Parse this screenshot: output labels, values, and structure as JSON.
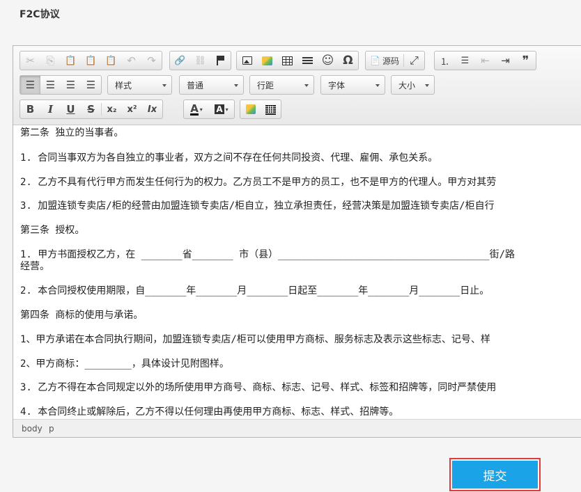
{
  "page": {
    "title": "F2C协议"
  },
  "toolbar": {
    "row1": {
      "clipboard": [
        {
          "icon": "cut-icon",
          "glyph": "✂"
        },
        {
          "icon": "copy-icon",
          "glyph": "⎘"
        },
        {
          "icon": "paste-icon",
          "glyph": "📋"
        },
        {
          "icon": "paste-text-icon",
          "glyph": "📋"
        },
        {
          "icon": "paste-word-icon",
          "glyph": "📋"
        },
        {
          "icon": "undo-icon",
          "glyph": "↶"
        },
        {
          "icon": "redo-icon",
          "glyph": "↷"
        }
      ],
      "link": [
        {
          "icon": "link-icon",
          "glyph": "🔗"
        },
        {
          "icon": "unlink-icon",
          "glyph": "⛓"
        },
        {
          "icon": "anchor-flag-icon",
          "glyph": ""
        }
      ],
      "insert": [
        {
          "icon": "image-icon"
        },
        {
          "icon": "photo-icon"
        },
        {
          "icon": "table-icon"
        },
        {
          "icon": "horizontal-rule-icon"
        },
        {
          "icon": "smiley-icon",
          "glyph": "☺"
        },
        {
          "icon": "special-char-icon",
          "glyph": "Ω"
        }
      ],
      "source_label": "源码",
      "maximize_glyph": "⤢",
      "lists": [
        {
          "icon": "numbered-list-icon",
          "glyph": "⒈"
        },
        {
          "icon": "bulleted-list-icon",
          "glyph": "☰"
        },
        {
          "icon": "outdent-icon",
          "glyph": "⇤"
        },
        {
          "icon": "indent-icon",
          "glyph": "⇥"
        },
        {
          "icon": "blockquote-icon",
          "glyph": "❞"
        }
      ]
    },
    "row2": {
      "align": [
        {
          "icon": "align-left-icon",
          "glyph": "☰"
        },
        {
          "icon": "align-center-icon",
          "glyph": "☰"
        },
        {
          "icon": "align-right-icon",
          "glyph": "☰"
        },
        {
          "icon": "align-justify-icon",
          "glyph": "☰"
        }
      ],
      "styles": "样式",
      "format": "普通",
      "line_height": "行距",
      "font": "字体",
      "size": "大小"
    },
    "row3": {
      "basic": [
        {
          "icon": "bold-icon",
          "glyph": "B"
        },
        {
          "icon": "italic-icon",
          "glyph": "I"
        },
        {
          "icon": "underline-icon",
          "glyph": "U"
        },
        {
          "icon": "strikethrough-icon",
          "glyph": "S"
        },
        {
          "icon": "subscript-icon",
          "glyph": "x₂"
        },
        {
          "icon": "superscript-icon",
          "glyph": "x²"
        },
        {
          "icon": "remove-format-icon",
          "glyph": "Ix"
        }
      ],
      "colors": [
        {
          "icon": "text-color-icon",
          "glyph": "A"
        },
        {
          "icon": "background-color-icon",
          "glyph": "A"
        }
      ],
      "extra": [
        {
          "icon": "image-gallery-icon"
        },
        {
          "icon": "qrcode-icon"
        }
      ]
    }
  },
  "content": {
    "paragraphs": [
      "第二条 独立的当事者。",
      "1. 合同当事双方为各自独立的事业者，双方之间不存在任何共同投资、代理、雇佣、承包关系。",
      "2. 乙方不具有代行甲方而发生任何行为的权力。乙方员工不是甲方的员工，也不是甲方的代理人。甲方对其劳",
      "3. 加盟连锁专卖店/柜的经营由加盟连锁专卖店/柜自立，独立承担责任，经营决策是加盟连锁专卖店/柜自行",
      "第三条 授权。",
      "1. 甲方书面授权乙方，在 _______省_______ 市（县）____________________________________街/路",
      "经营。",
      "2. 本合同授权使用期限，自_______年_______月_______日起至_______年_______月_______日止。",
      "第四条 商标的使用与承诺。",
      "1、甲方承诺在本合同执行期间，加盟连锁专卖店/柜可以使用甲方商标、服务标志及表示这些标志、记号、样",
      "2、甲方商标：________，具体设计见附图样。",
      "3. 乙方不得在本合同规定以外的场所使用甲方商号、商标、标志、记号、样式、标签和招牌等，同时严禁使用",
      "4. 本合同终止或解除后，乙方不得以任何理由再使用甲方商标、标志、样式、招牌等。"
    ]
  },
  "statusbar": {
    "path": [
      "body",
      "p"
    ]
  },
  "submit": {
    "label": "提交"
  },
  "colors": {
    "accent": "#1aa3e6",
    "highlight_border": "#e03a3a"
  }
}
